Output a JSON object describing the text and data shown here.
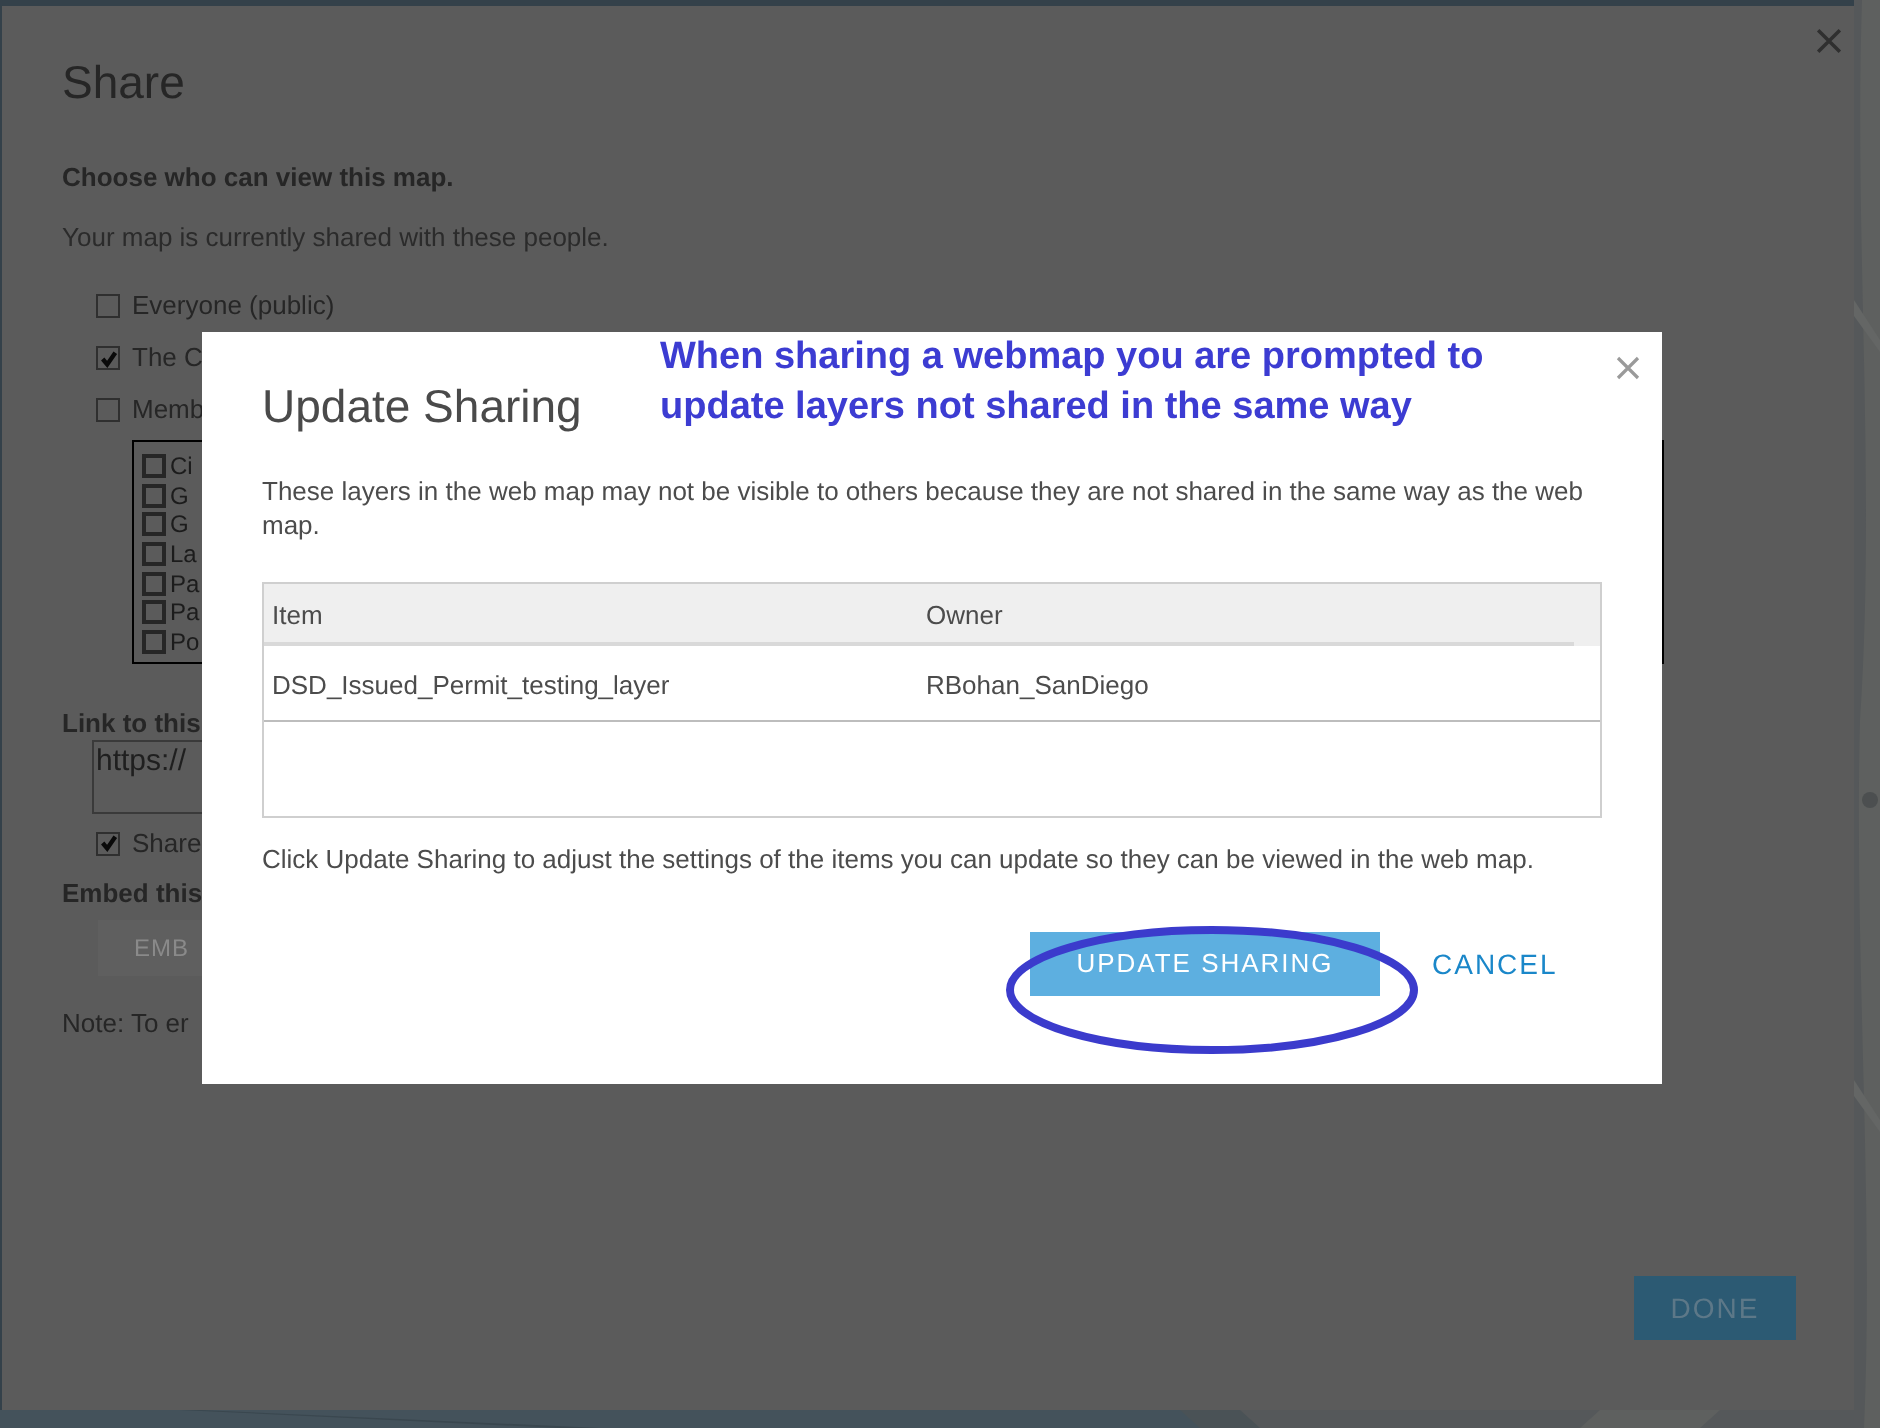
{
  "share_dialog": {
    "title": "Share",
    "heading": "Choose who can view this map.",
    "subtext": "Your map is currently shared with these people.",
    "audience": [
      {
        "label": "Everyone (public)",
        "checked": false
      },
      {
        "label": "The C",
        "checked": true
      },
      {
        "label": "Memb",
        "checked": false
      }
    ],
    "groups": [
      {
        "label": "Ci",
        "checked": false
      },
      {
        "label": "G",
        "checked": false
      },
      {
        "label": "G",
        "checked": false
      },
      {
        "label": "La",
        "checked": false
      },
      {
        "label": "Pa",
        "checked": false
      },
      {
        "label": "Pa",
        "checked": false
      },
      {
        "label": "Po",
        "checked": false
      }
    ],
    "link_label": "Link to this",
    "link_value": "https://",
    "share_option": {
      "label": "Share",
      "checked": true
    },
    "embed_label": "Embed this",
    "embed_button": "EMB",
    "note": "Note: To er",
    "done_button": "DONE"
  },
  "update_dialog": {
    "title": "Update Sharing",
    "message": "These layers in the web map may not be visible to others because they are not shared in the same way as the web map.",
    "table": {
      "columns": [
        "Item",
        "Owner"
      ],
      "rows": [
        [
          "DSD_Issued_Permit_testing_layer",
          "RBohan_SanDiego"
        ]
      ]
    },
    "footer": "Click Update Sharing to adjust the settings of the items you can update so they can be viewed in the web map.",
    "primary_button": "UPDATE SHARING",
    "cancel_button": "CANCEL"
  },
  "annotation": {
    "text": "When sharing a webmap you are prompted to update layers not shared in the same way"
  }
}
